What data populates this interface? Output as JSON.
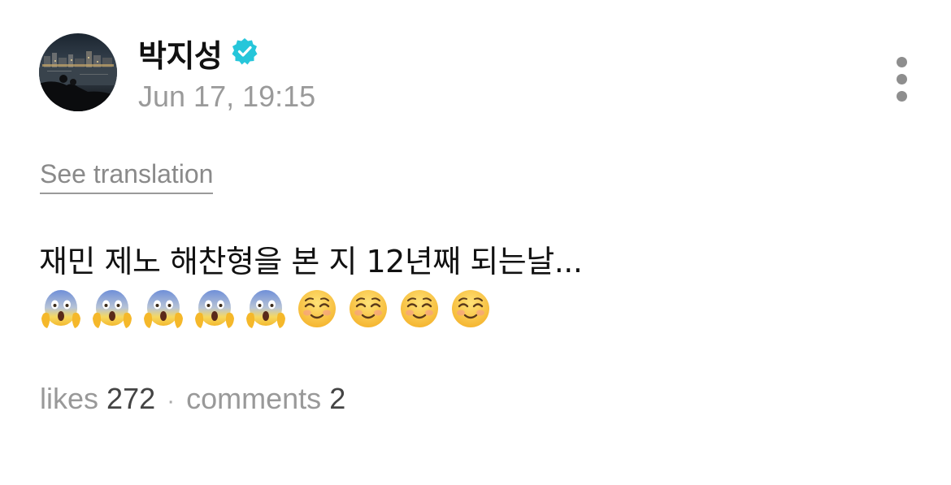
{
  "author": {
    "name": "박지성",
    "verified": true,
    "verified_color": "#26c6da",
    "avatar_icon": "night-city-river-photo"
  },
  "post": {
    "timestamp": "Jun 17, 19:15",
    "translate_label": "See translation",
    "text": "재민 제노 해찬형을 본 지 12년째 되는날...",
    "emojis": [
      "face-screaming-in-fear",
      "face-screaming-in-fear",
      "face-screaming-in-fear",
      "face-screaming-in-fear",
      "face-screaming-in-fear",
      "smiling-face",
      "smiling-face",
      "smiling-face",
      "smiling-face"
    ]
  },
  "stats": {
    "likes_label": "likes",
    "likes_count": "272",
    "separator": "·",
    "comments_label": "comments",
    "comments_count": "2"
  },
  "menu": {
    "icon": "more-vertical-icon"
  }
}
